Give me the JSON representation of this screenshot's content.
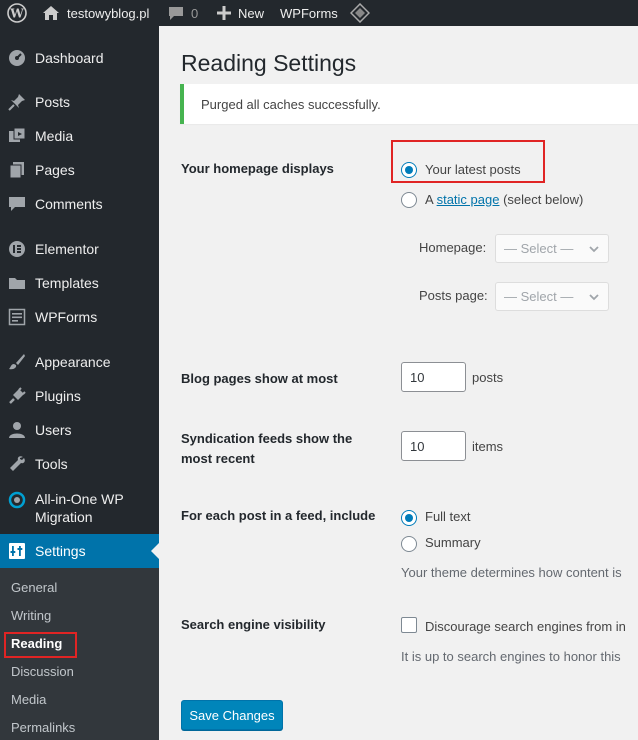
{
  "admin_bar": {
    "site_name": "testowyblog.pl",
    "comments_count": "0",
    "new_label": "New",
    "wpforms_label": "WPForms"
  },
  "sidebar": {
    "items": [
      {
        "label": "Dashboard",
        "icon": "dashboard-icon"
      },
      {
        "label": "Posts",
        "icon": "pin-icon"
      },
      {
        "label": "Media",
        "icon": "media-icon"
      },
      {
        "label": "Pages",
        "icon": "pages-icon"
      },
      {
        "label": "Comments",
        "icon": "comment-icon"
      },
      {
        "label": "Elementor",
        "icon": "elementor-icon"
      },
      {
        "label": "Templates",
        "icon": "folder-icon"
      },
      {
        "label": "WPForms",
        "icon": "forms-icon"
      },
      {
        "label": "Appearance",
        "icon": "brush-icon"
      },
      {
        "label": "Plugins",
        "icon": "plug-icon"
      },
      {
        "label": "Users",
        "icon": "user-icon"
      },
      {
        "label": "Tools",
        "icon": "wrench-icon"
      },
      {
        "label": "All-in-One WP",
        "label2": "Migration",
        "icon": "migration-icon"
      },
      {
        "label": "Settings",
        "icon": "settings-icon"
      }
    ],
    "submenu": [
      "General",
      "Writing",
      "Reading",
      "Discussion",
      "Media",
      "Permalinks"
    ]
  },
  "main": {
    "title": "Reading Settings",
    "notice": "Purged all caches successfully.",
    "homepage_displays": {
      "label": "Your homepage displays",
      "option_latest": "Your latest posts",
      "option_static_prefix": "A",
      "option_static_link": "static page",
      "option_static_suffix": "(select below)",
      "homepage_label": "Homepage:",
      "posts_page_label": "Posts page:",
      "select_placeholder": "— Select —"
    },
    "blog_pages": {
      "label": "Blog pages show at most",
      "value": "10",
      "unit": "posts"
    },
    "syndication": {
      "label_line1": "Syndication feeds show the",
      "label_line2": "most recent",
      "value": "10",
      "unit": "items"
    },
    "feed_include": {
      "label": "For each post in a feed, include",
      "option_full": "Full text",
      "option_summary": "Summary",
      "description": "Your theme determines how content is"
    },
    "search_visibility": {
      "label": "Search engine visibility",
      "checkbox_label": "Discourage search engines from in",
      "description": "It is up to search engines to honor this"
    },
    "save_button": "Save Changes"
  },
  "colors": {
    "admin_dark": "#23282d",
    "submenu_bg": "#32373c",
    "accent": "#0073aa",
    "button": "#0085ba",
    "notice_success": "#46b450",
    "highlight_box": "#e02424"
  }
}
